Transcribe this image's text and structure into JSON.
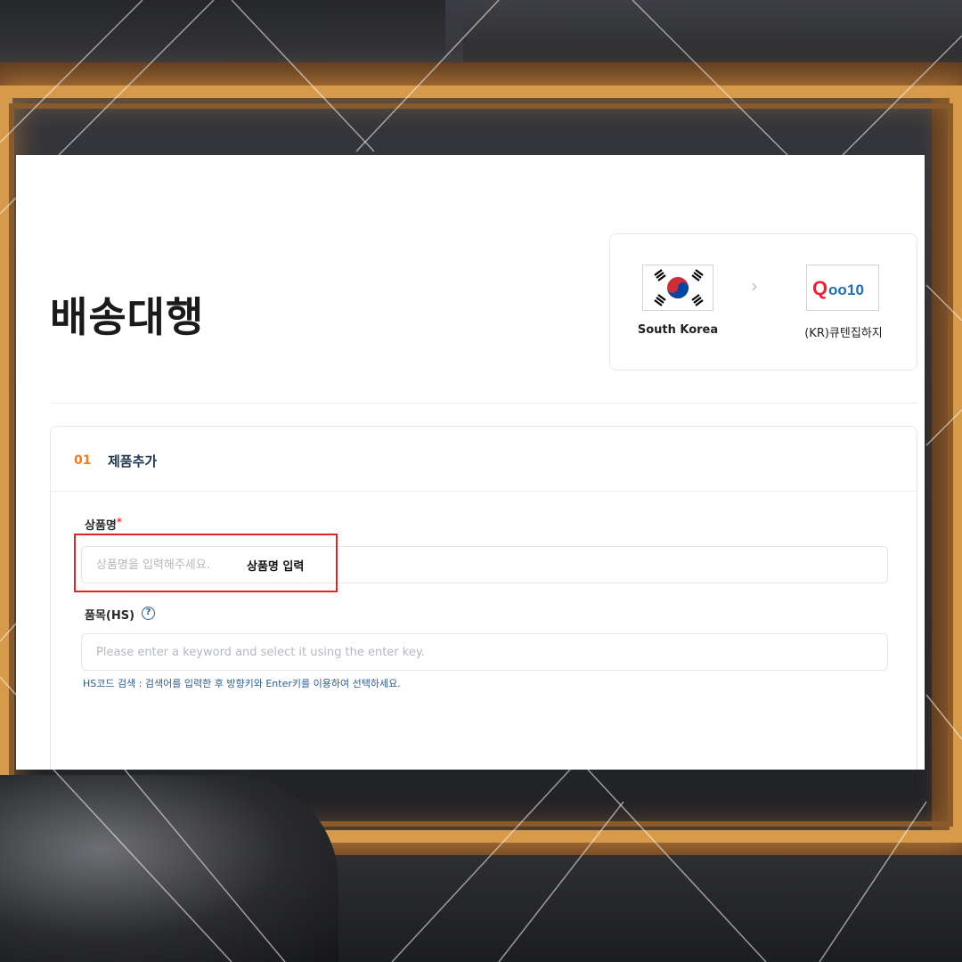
{
  "page": {
    "title": "배송대행"
  },
  "route": {
    "origin_label": "South Korea",
    "origin_icon": "south-korea-flag-icon",
    "arrow_icon": "chevron-right-icon",
    "destination_label": "(KR)큐텐집하지",
    "destination_icon": "qoo10-logo-icon",
    "destination_logo_text": "Qoo10"
  },
  "section": {
    "number": "01",
    "title": "제품추가"
  },
  "product_name": {
    "label": "상품명",
    "required_mark": "*",
    "placeholder": "상품명을 입력해주세요.",
    "value": "",
    "annotation": "상품명 입력"
  },
  "hs_code": {
    "label": "품목(HS)",
    "help_icon": "question-circle-icon",
    "help_text": "?",
    "placeholder": "Please enter a keyword and select it using the enter key.",
    "value": "",
    "hint": "HS코드 검색 : 검색어를 입력한 후 방향키와 Enter키를 이용하여 선택하세요."
  },
  "colors": {
    "accent_orange": "#f07c1e",
    "section_title_navy": "#1f3550",
    "hint_blue": "#2d5b8a",
    "highlight_red": "#e02424",
    "frame_gold": "#d79a4a"
  }
}
